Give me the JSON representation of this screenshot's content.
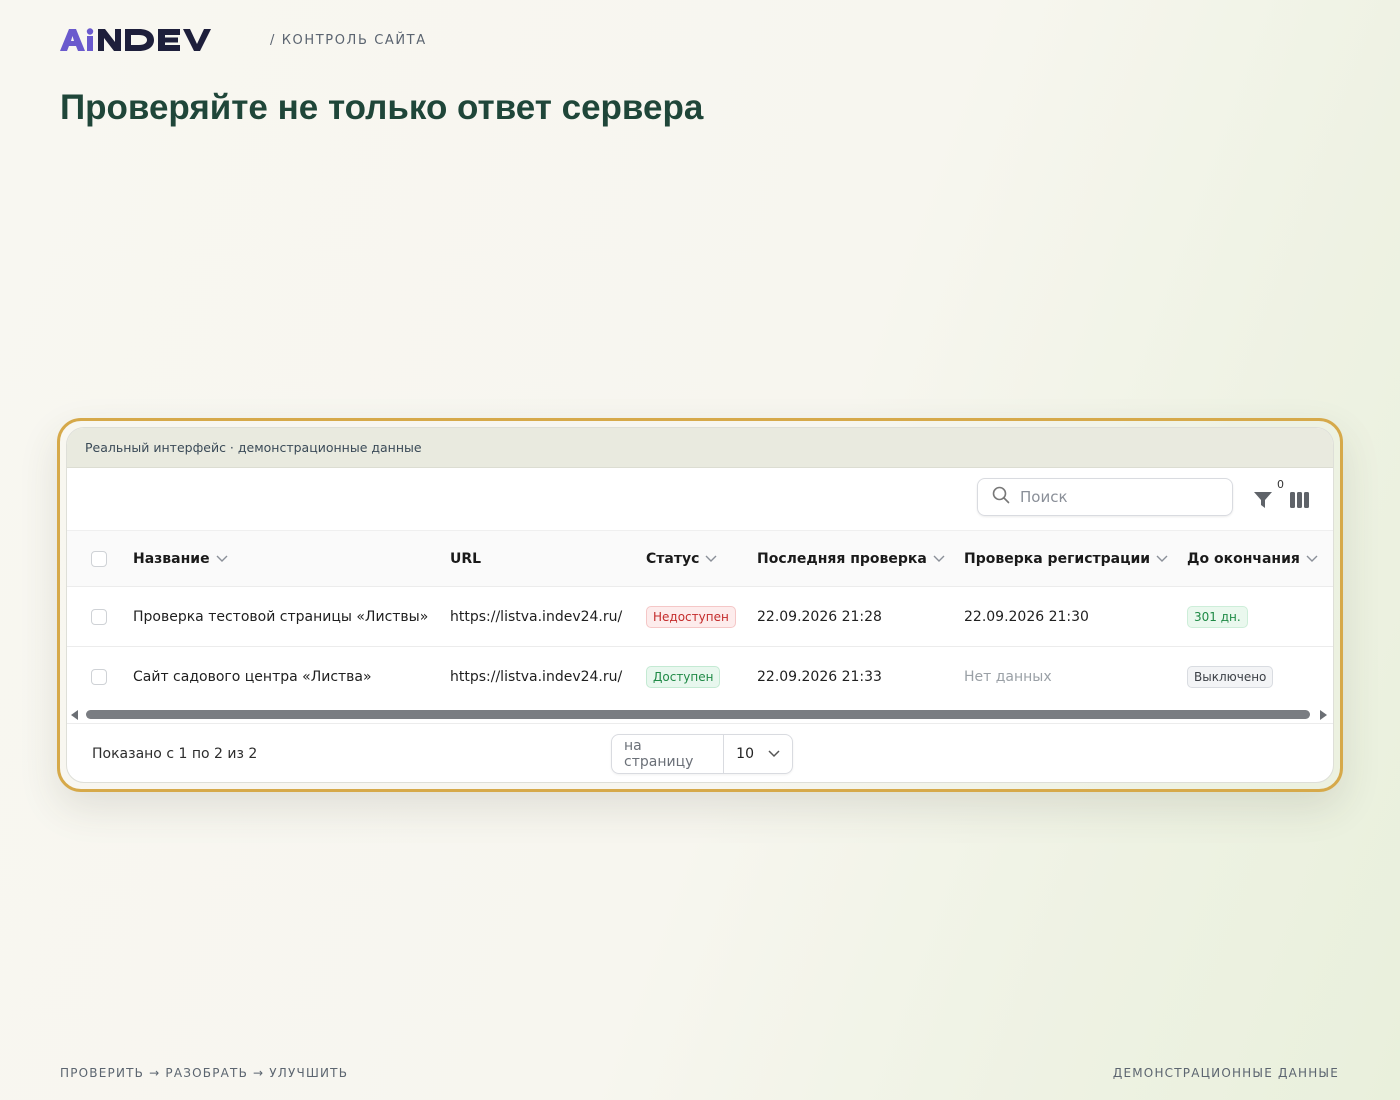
{
  "header": {
    "logo_text": "AiNDEV",
    "section": "/ КОНТРОЛЬ САЙТА",
    "headline": "Проверяйте не только ответ сервера"
  },
  "panel": {
    "caption": "Реальный интерфейс · демонстрационные данные",
    "search": {
      "placeholder": "Поиск",
      "value": ""
    },
    "filter_count": "0"
  },
  "table": {
    "columns": [
      "Название",
      "URL",
      "Статус",
      "Последняя проверка",
      "Проверка регистрации",
      "До окончания"
    ],
    "rows": [
      {
        "name": "Проверка тестовой страницы «Листвы»",
        "url": "https://listva.indev24.ru/",
        "status": "Недоступен",
        "last_check": "22.09.2026 21:28",
        "reg_check": "22.09.2026 21:30",
        "until_end": "301 дн."
      },
      {
        "name": "Сайт садового центра «Листва»",
        "url": "https://listva.indev24.ru/",
        "status": "Доступен",
        "last_check": "22.09.2026 21:33",
        "reg_check": "Нет данных",
        "until_end": "Выключено"
      }
    ]
  },
  "footer": {
    "shown": "Показано с 1 по 2 из 2",
    "per_page_label": "на страницу",
    "per_page_value": "10"
  },
  "bottom": {
    "left": "ПРОВЕРИТЬ → РАЗОБРАТЬ → УЛУЧШИТЬ",
    "right": "ДЕМОНСТРАЦИОННЫЕ ДАННЫЕ"
  },
  "colors": {
    "accent_frame": "#d6a94a",
    "headline": "#1f4639",
    "logo_purple": "#6a5acd",
    "status_error": "#c42b2b",
    "status_ok": "#1f8a46"
  }
}
